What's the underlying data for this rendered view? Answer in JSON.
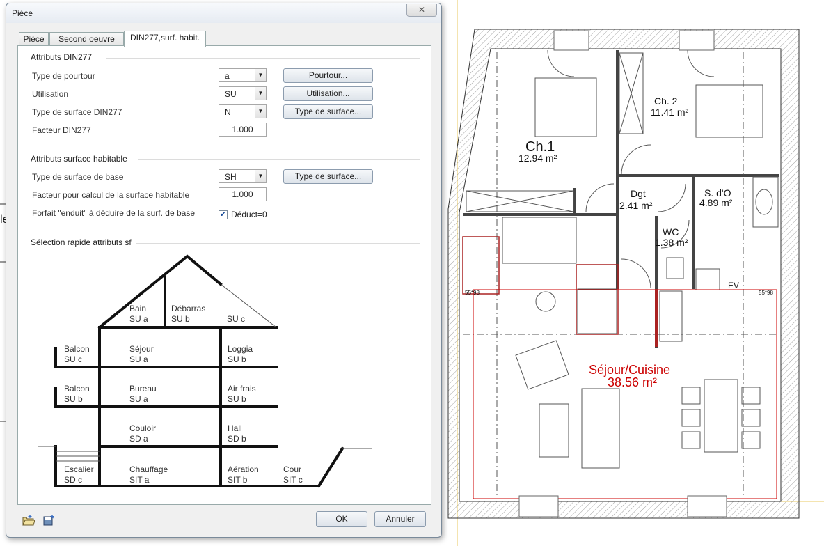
{
  "window": {
    "title": "Pièce",
    "close_glyph": "✕"
  },
  "tabs": [
    {
      "label": "Pièce",
      "active": false
    },
    {
      "label": "Second oeuvre",
      "active": false
    },
    {
      "label": "DIN277,surf. habit.",
      "active": true
    }
  ],
  "din277": {
    "group_title": "Attributs DIN277",
    "rows": [
      {
        "label": "Type de pourtour",
        "value": "a",
        "button": "Pourtour..."
      },
      {
        "label": "Utilisation",
        "value": "SU",
        "button": "Utilisation..."
      },
      {
        "label": "Type de surface DIN277",
        "value": "N",
        "button": "Type de surface..."
      },
      {
        "label": "Facteur DIN277",
        "value": "1.000"
      }
    ]
  },
  "habitable": {
    "group_title": "Attributs surface habitable",
    "base_type_label": "Type de surface de base",
    "base_type_value": "SH",
    "base_type_button": "Type de surface...",
    "factor_label": "Facteur pour calcul de la surface habitable",
    "factor_value": "1.000",
    "forfait_label": "Forfait \"enduit\" à déduire de la surf. de base",
    "deduct_checked": true,
    "deduct_label": "Déduct=0"
  },
  "quick_select": {
    "group_title": "Sélection rapide attributs sf",
    "labels": [
      {
        "name": "Bain",
        "code": "SU a"
      },
      {
        "name": "Débarras",
        "code": "SU b"
      },
      {
        "name": "",
        "code": "SU c"
      },
      {
        "name": "Balcon",
        "code": "SU c"
      },
      {
        "name": "Séjour",
        "code": "SU a"
      },
      {
        "name": "Loggia",
        "code": "SU b"
      },
      {
        "name": "Balcon",
        "code": "SU b"
      },
      {
        "name": "Bureau",
        "code": "SU a"
      },
      {
        "name": "Air frais",
        "code": "SU b"
      },
      {
        "name": "Couloir",
        "code": "SD a"
      },
      {
        "name": "Hall",
        "code": "SD b"
      },
      {
        "name": "Escalier",
        "code": "SD c"
      },
      {
        "name": "Chauffage",
        "code": "SIT a"
      },
      {
        "name": "Aération",
        "code": "SIT b"
      },
      {
        "name": "Cour",
        "code": "SIT c"
      }
    ]
  },
  "footer": {
    "ok": "OK",
    "cancel": "Annuler"
  },
  "plan": {
    "rooms": [
      {
        "name": "Ch.1",
        "area": "12.94 m²"
      },
      {
        "name": "Ch. 2",
        "area": "11.41 m²"
      },
      {
        "name": "Dgt",
        "area": "2.41 m²"
      },
      {
        "name": "S. d'O",
        "area": "4.89 m²"
      },
      {
        "name": "WC",
        "area": "1.38 m²"
      },
      {
        "name": "Séjour/Cuisine",
        "area": "38.56 m²"
      }
    ],
    "tags": [
      "55*98",
      "55*98",
      "EV"
    ],
    "side_glyph": "le",
    "highlight_color": "#cc0000"
  }
}
